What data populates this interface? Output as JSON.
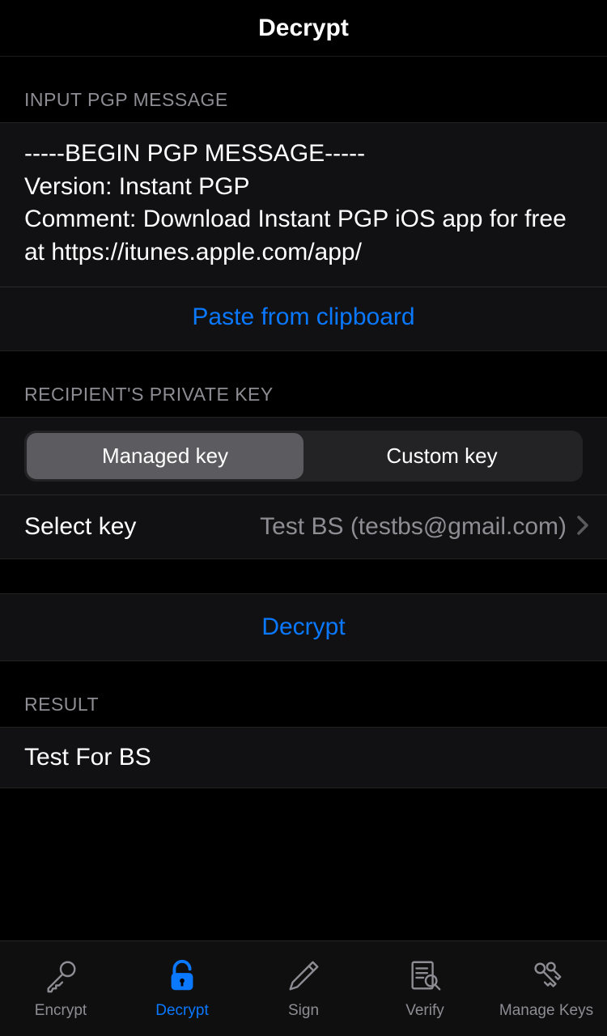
{
  "navbar": {
    "title": "Decrypt"
  },
  "sections": {
    "input_header": "INPUT PGP MESSAGE",
    "key_header": "RECIPIENT'S PRIVATE KEY",
    "result_header": "RESULT"
  },
  "input": {
    "pgp_message": "-----BEGIN PGP MESSAGE-----\nVersion: Instant PGP\nComment: Download Instant PGP iOS app for free at https://itunes.apple.com/app/",
    "paste_label": "Paste from clipboard"
  },
  "key": {
    "segments": {
      "managed": "Managed key",
      "custom": "Custom key"
    },
    "select_label": "Select key",
    "select_value": "Test BS (testbs@gmail.com)"
  },
  "action": {
    "decrypt_label": "Decrypt"
  },
  "result": {
    "text": "Test For BS"
  },
  "tabs": {
    "encrypt": "Encrypt",
    "decrypt": "Decrypt",
    "sign": "Sign",
    "verify": "Verify",
    "manage": "Manage Keys"
  }
}
